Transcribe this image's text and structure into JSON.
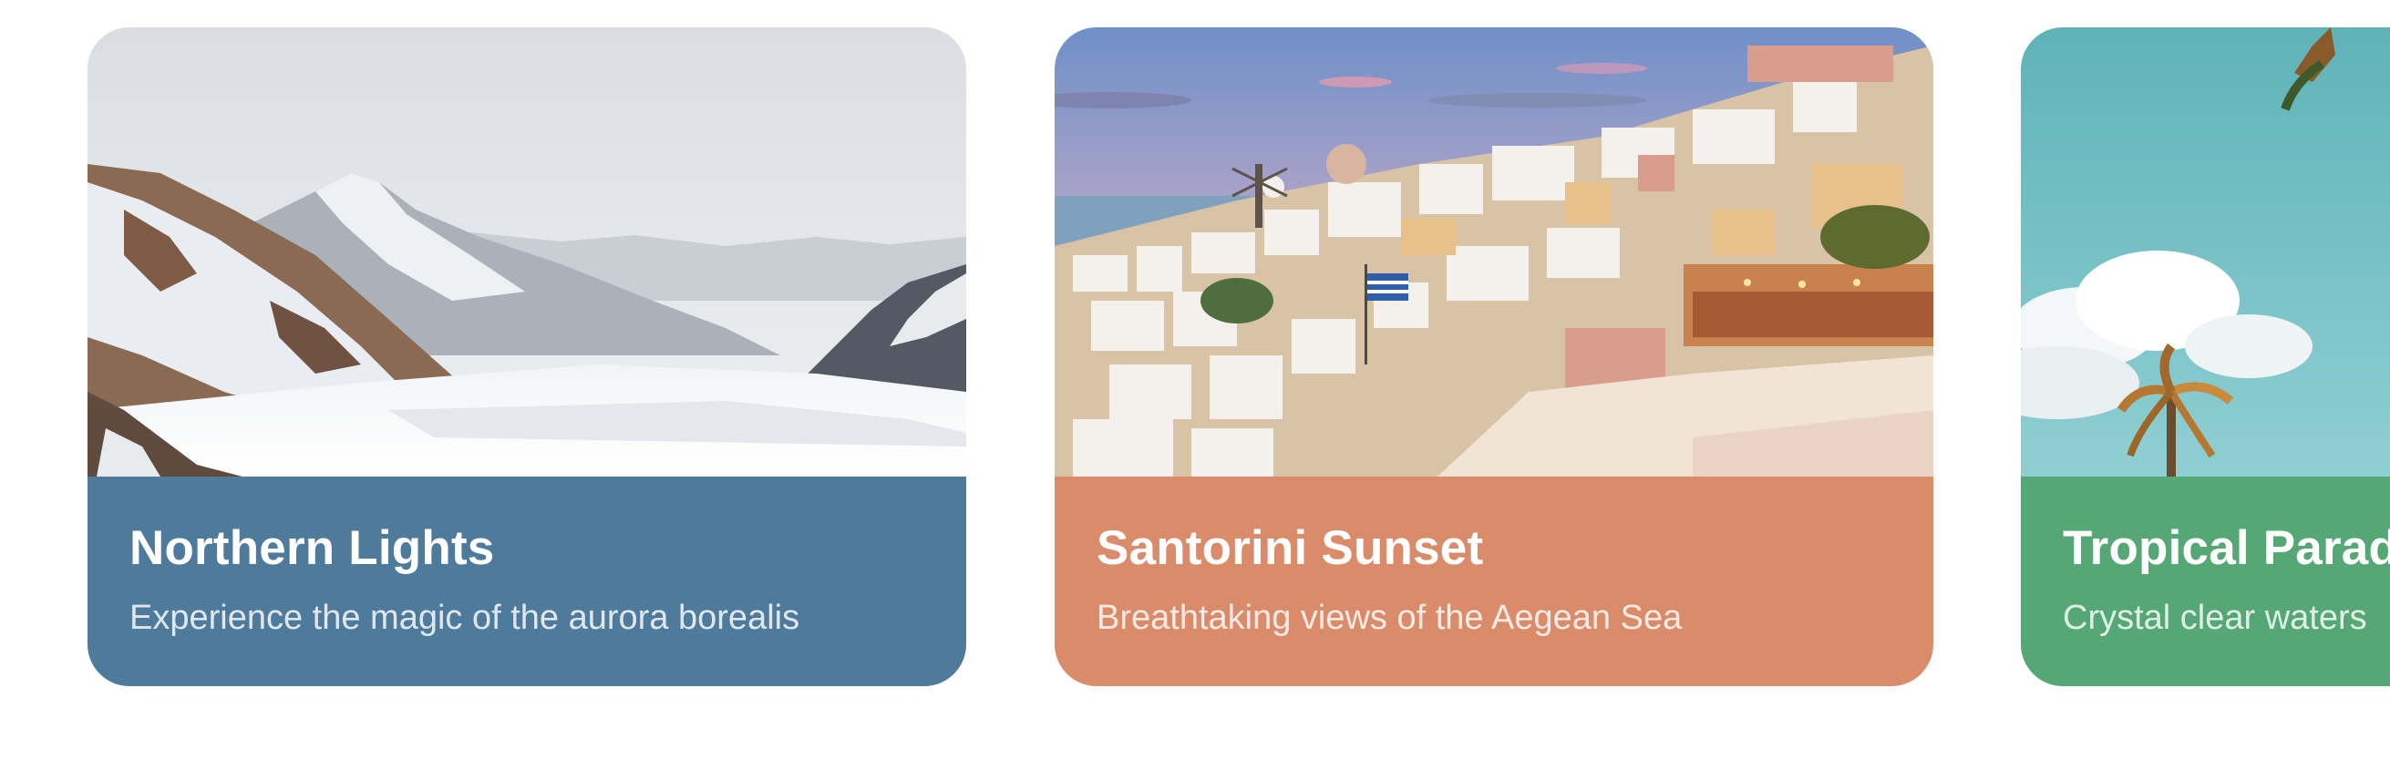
{
  "cards": [
    {
      "title": "Northern Lights",
      "subtitle": "Experience the magic of the aurora borealis",
      "color": "#4e7a9b",
      "image": "snowy-mountain-glacier-photo"
    },
    {
      "title": "Santorini Sunset",
      "subtitle": "Breathtaking views of the Aegean Sea",
      "color": "#d98b6a",
      "image": "santorini-village-sunset-photo"
    },
    {
      "title": "Tropical Paradise",
      "subtitle": "Crystal clear waters",
      "color": "#55a875",
      "image": "tropical-sky-palm-photo"
    }
  ]
}
